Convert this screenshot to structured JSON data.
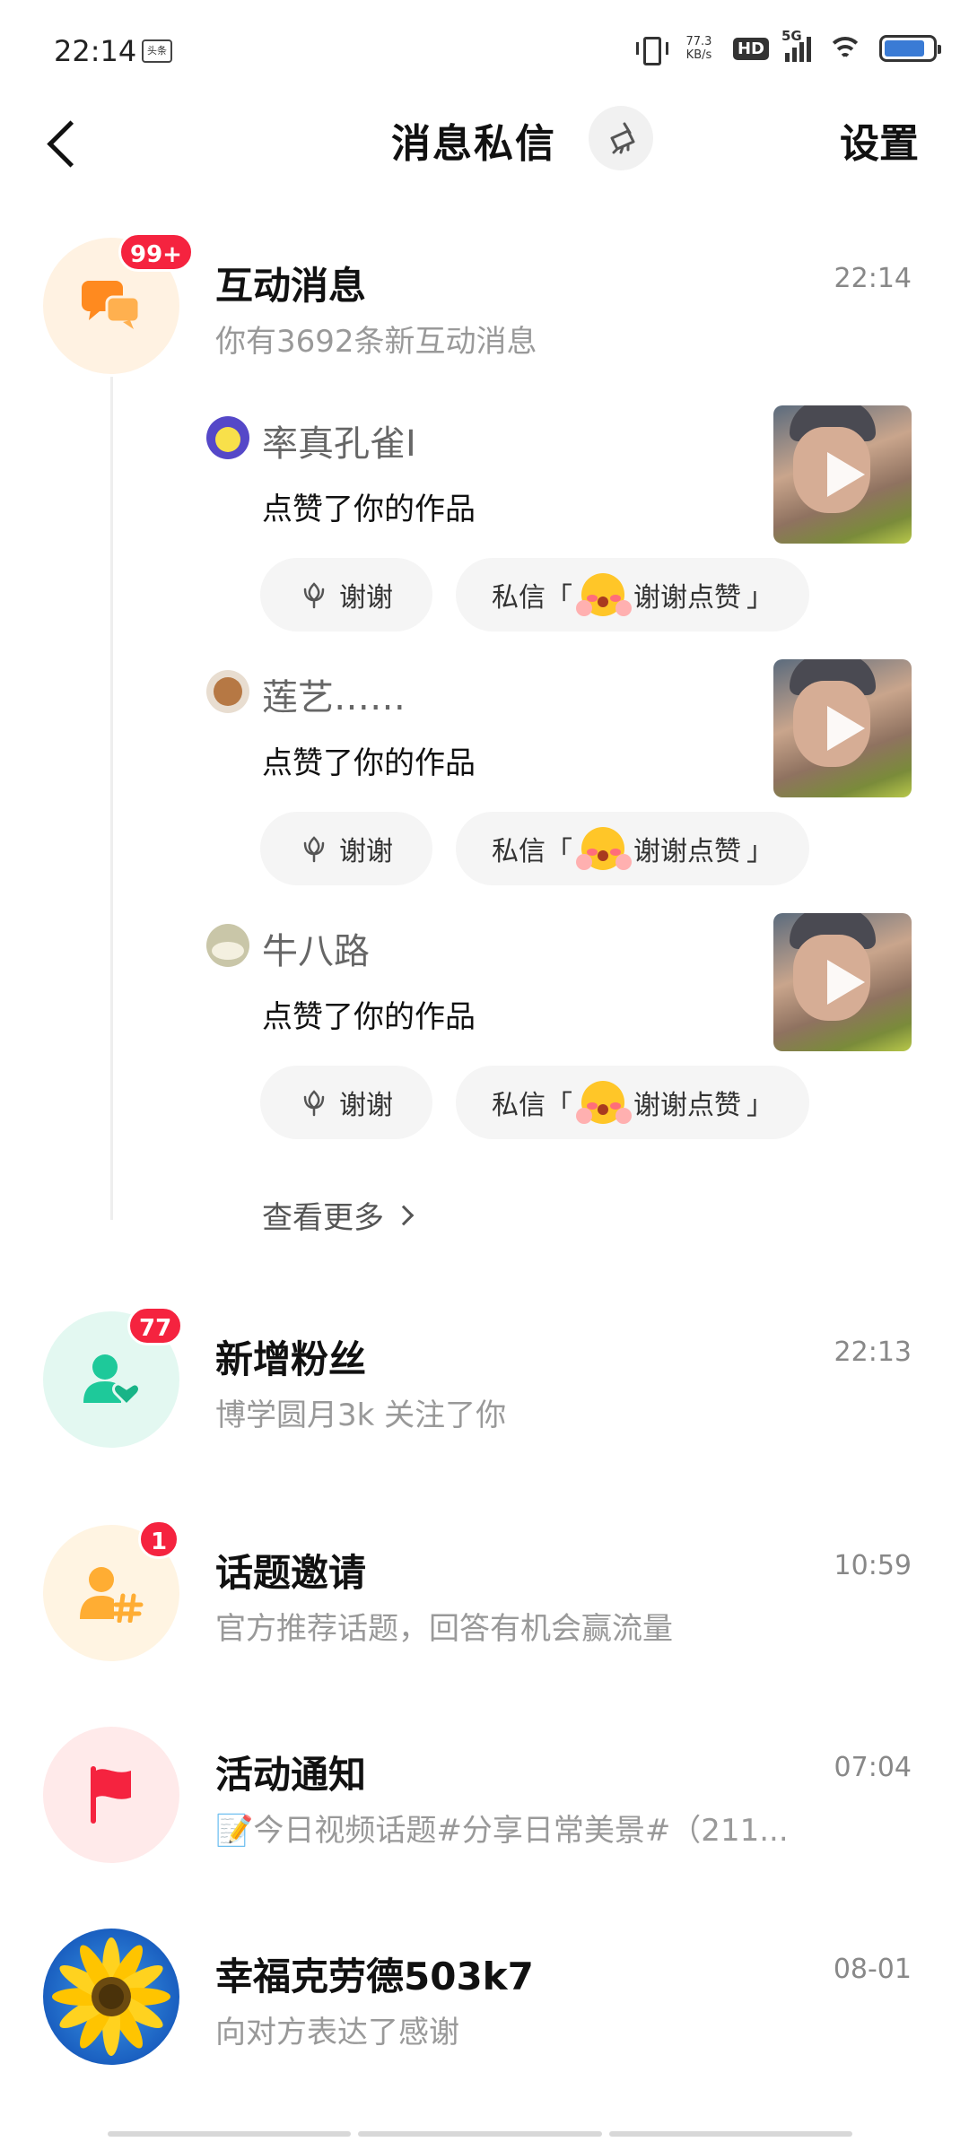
{
  "status_bar": {
    "time": "22:14",
    "app_badge": "头条",
    "net_speed_value": "77.3",
    "net_speed_unit": "KB/s",
    "hd": "HD",
    "signal_label": "5G",
    "battery_level": 0.85
  },
  "header": {
    "title": "消息私信",
    "settings_label": "设置"
  },
  "interaction": {
    "title": "互动消息",
    "time": "22:14",
    "subtitle": "你有3692条新互动消息",
    "badge": "99+",
    "color": "#ff8a1f",
    "items": [
      {
        "user": "率真孔雀I",
        "action": "点赞了你的作品",
        "thanks_label": "谢谢",
        "dm_prefix": "私信「",
        "dm_text": "谢谢点赞",
        "dm_suffix": "」"
      },
      {
        "user": "莲艺……",
        "action": "点赞了你的作品",
        "thanks_label": "谢谢",
        "dm_prefix": "私信「",
        "dm_text": "谢谢点赞",
        "dm_suffix": "」"
      },
      {
        "user": "牛八路",
        "action": "点赞了你的作品",
        "thanks_label": "谢谢",
        "dm_prefix": "私信「",
        "dm_text": "谢谢点赞",
        "dm_suffix": "」"
      }
    ],
    "see_more": "查看更多"
  },
  "new_fans": {
    "title": "新增粉丝",
    "time": "22:13",
    "subtitle": "博学圆月3k 关注了你",
    "badge": "77",
    "color": "#1ec99a"
  },
  "topic_invite": {
    "title": "话题邀请",
    "time": "10:59",
    "subtitle": "官方推荐话题，回答有机会赢流量",
    "badge": "1",
    "color": "#ffad33"
  },
  "activity": {
    "title": "活动通知",
    "time": "07:04",
    "subtitle": "📝今日视频话题#分享日常美景#（211...",
    "color": "#f5233f"
  },
  "chat": {
    "title": "幸福克劳德503k7",
    "time": "08-01",
    "subtitle": "向对方表达了感谢"
  }
}
